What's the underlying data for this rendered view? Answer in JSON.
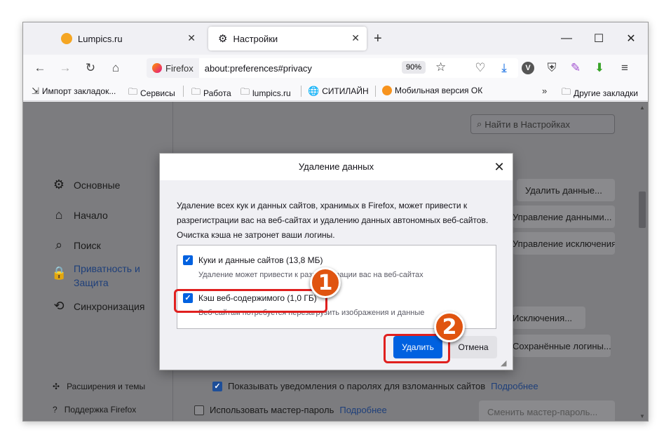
{
  "tabs": [
    {
      "title": "Lumpics.ru",
      "active": false
    },
    {
      "title": "Настройки",
      "active": true
    }
  ],
  "nav": {
    "browser_label": "Firefox",
    "url": "about:preferences#privacy",
    "zoom": "90%"
  },
  "bookmarks": [
    {
      "label": "Импорт закладок...",
      "icon": "import-icon"
    },
    {
      "label": "Сервисы",
      "icon": "folder-icon"
    },
    {
      "label": "Работа",
      "icon": "folder-icon"
    },
    {
      "label": "lumpics.ru",
      "icon": "folder-icon"
    },
    {
      "label": "СИТИЛАЙН",
      "icon": "globe-icon"
    },
    {
      "label": "Мобильная версия ОК",
      "icon": "ok-icon"
    },
    {
      "label": "Другие закладки",
      "icon": "folder-icon"
    }
  ],
  "sidebar": {
    "items": [
      {
        "label": "Основные",
        "icon": "gear-icon"
      },
      {
        "label": "Начало",
        "icon": "home-icon"
      },
      {
        "label": "Поиск",
        "icon": "search-icon"
      },
      {
        "label_line1": "Приватность и",
        "label_line2": "Защита",
        "icon": "lock-icon"
      },
      {
        "label": "Синхронизация",
        "icon": "sync-icon"
      }
    ],
    "footer": [
      {
        "label": "Расширения и темы",
        "icon": "puzzle-icon"
      },
      {
        "label": "Поддержка Firefox",
        "icon": "help-icon"
      }
    ]
  },
  "main": {
    "search_placeholder": "Найти в Настройках",
    "buttons": {
      "clear_data": "Удалить данные...",
      "manage_data": "Управление данными...",
      "manage_exceptions": "Управление исключениями...",
      "exceptions": "Исключения...",
      "saved_logins": "Сохранённые логины...",
      "change_master": "Сменить мастер-пароль..."
    },
    "breach_alerts": {
      "label": "Показывать уведомления о паролях для взломанных сайтов",
      "link": "Подробнее",
      "checked": true
    },
    "master_password": {
      "label": "Использовать мастер-пароль",
      "link": "Подробнее",
      "checked": false
    }
  },
  "dialog": {
    "title": "Удаление данных",
    "description_line1": "Удаление всех кук и данных сайтов, хранимых в Firefox, может привести к",
    "description_line2": "разрегистрации вас на веб-сайтах и удалению данных автономных веб-сайтов.",
    "description_line3": "Очистка кэша не затронет ваши логины.",
    "options": [
      {
        "label": "Куки и данные сайтов (13,8 МБ)",
        "note": "Удаление может привести к разрегистрации вас на веб-сайтах",
        "checked": true
      },
      {
        "label": "Кэш веб-содержимого (1,0 ГБ)",
        "note": "Веб-сайтам потребуется перезагрузить изображения и данные",
        "checked": true
      }
    ],
    "delete_label": "Удалить",
    "cancel_label": "Отмена"
  },
  "annotations": {
    "marker1": "1",
    "marker2": "2",
    "highlight_color": "#e0201f",
    "marker_color": "#e05410"
  },
  "colors": {
    "accent": "#0061e0",
    "overlay": "#7c7c7f"
  }
}
